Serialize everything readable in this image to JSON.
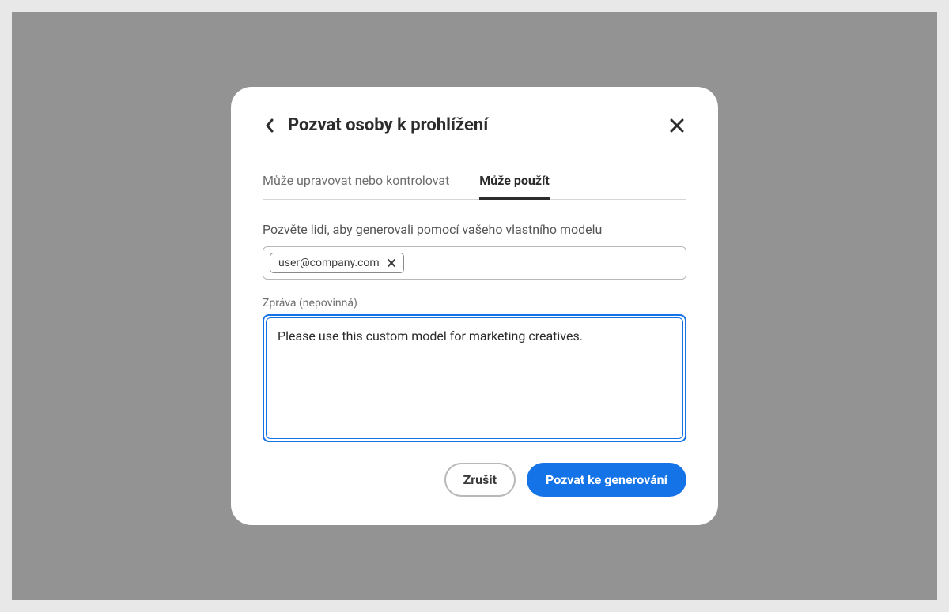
{
  "dialog": {
    "title": "Pozvat osoby k prohlížení",
    "tabs": [
      {
        "label": "Může upravovat nebo kontrolovat",
        "active": false
      },
      {
        "label": "Může použít",
        "active": true
      }
    ],
    "instruction": "Pozvěte lidi, aby generovali pomocí vašeho vlastního modelu",
    "email_chips": [
      {
        "value": "user@company.com"
      }
    ],
    "message_label": "Zpráva (nepovinná)",
    "message_value": "Please use this custom model for marketing creatives.",
    "actions": {
      "cancel": "Zrušit",
      "invite": "Pozvat ke generování"
    }
  }
}
